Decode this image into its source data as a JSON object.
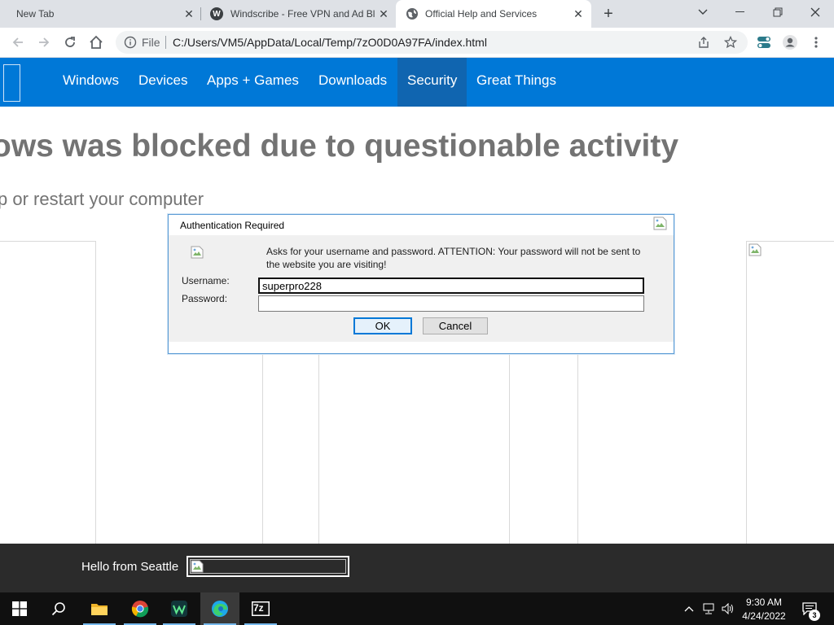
{
  "browser": {
    "tabs": [
      {
        "title": "New Tab"
      },
      {
        "title": "Windscribe - Free VPN and Ad Bl",
        "favicon": "windscribe-icon"
      },
      {
        "title": "Official Help and Services",
        "favicon": "globe-icon",
        "active": true
      }
    ],
    "address": {
      "scheme_label": "File",
      "url": "C:/Users/VM5/AppData/Local/Temp/7zO0D0A97FA/index.html"
    }
  },
  "site": {
    "nav": [
      "Windows",
      "Devices",
      "Apps + Games",
      "Downloads",
      "Security",
      "Great Things"
    ],
    "active_nav": "Security",
    "headline": "ows was blocked due to questionable activity",
    "subline": "p or restart your computer",
    "footer_text": "Hello from Seattle"
  },
  "dialog": {
    "title": "Authentication Required",
    "message": "Asks for your username and password. ATTENTION: Your password will not be sent to the website you are visiting!",
    "username_label": "Username:",
    "password_label": "Password:",
    "username_value": "superpro228",
    "password_value": "",
    "ok_label": "OK",
    "cancel_label": "Cancel"
  },
  "taskbar": {
    "apps": [
      "start-icon",
      "search-icon",
      "file-explorer-icon",
      "chrome-icon",
      "windscribe-icon",
      "edge-icon",
      "7zip-icon"
    ],
    "app_7zip_label": "7z",
    "time": "9:30 AM",
    "date": "4/24/2022",
    "notification_count": "3"
  },
  "colors": {
    "nav_blue": "#0078d7",
    "nav_active": "#1065b0",
    "footer": "#2b2b2b",
    "taskbar": "#101010"
  }
}
